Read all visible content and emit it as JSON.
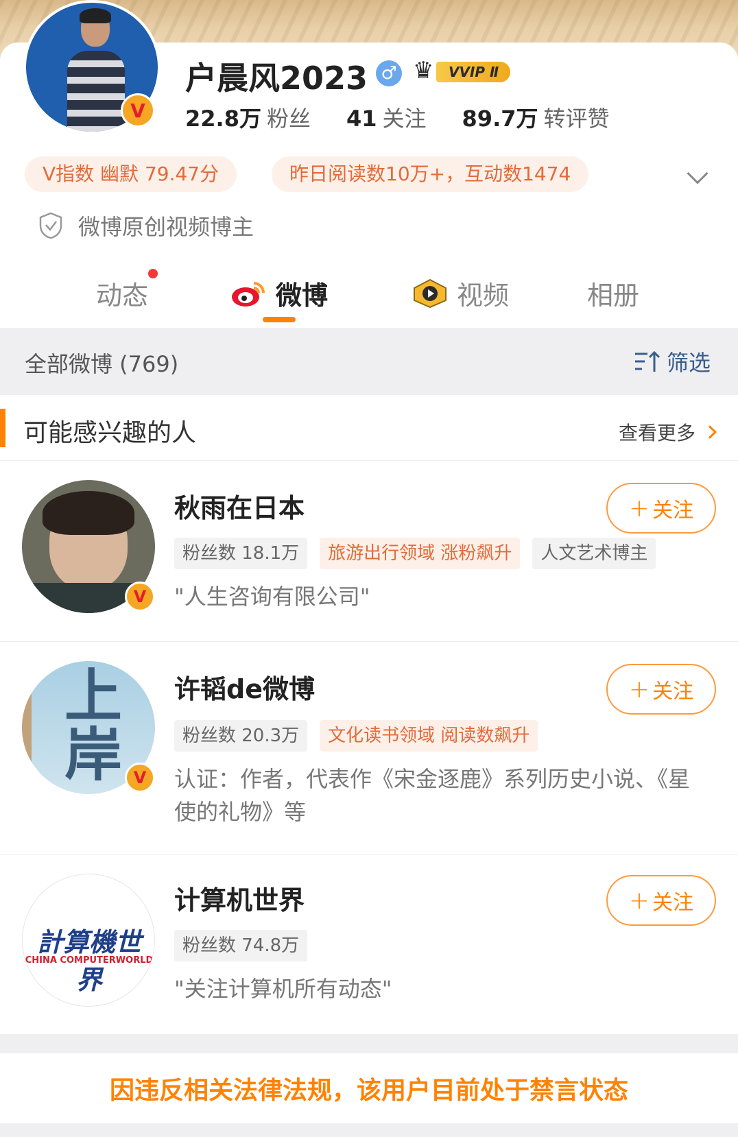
{
  "profile": {
    "name": "户晨风2023",
    "gender_symbol": "♂",
    "membership_badge": "VVIP Ⅱ",
    "verified_badge": "V",
    "stats": [
      {
        "value": "22.8万",
        "label": "粉丝"
      },
      {
        "value": "41",
        "label": "关注"
      },
      {
        "value": "89.7万",
        "label": "转评赞"
      }
    ],
    "chips": [
      "V指数 幽默 79.47分",
      "昨日阅读数10万+，互动数1474"
    ],
    "certification": "微博原创视频博主"
  },
  "tabs": [
    {
      "label": "动态",
      "icon": "",
      "has_dot": true
    },
    {
      "label": "微博",
      "icon": "weibo-logo-icon",
      "active": true
    },
    {
      "label": "视频",
      "icon": "video-play-icon"
    },
    {
      "label": "相册",
      "icon": ""
    }
  ],
  "filter_bar": {
    "count_text": "全部微博 (769)",
    "filter_label": "筛选"
  },
  "suggestions": {
    "title": "可能感兴趣的人",
    "more_label": "查看更多",
    "follow_label": "关注",
    "items": [
      {
        "name": "秋雨在日本",
        "tags": [
          {
            "text": "粉丝数 18.1万",
            "style": "gray"
          },
          {
            "text": "旅游出行领域 涨粉飙升",
            "style": "hot"
          },
          {
            "text": "人文艺术博主",
            "style": "gray"
          }
        ],
        "desc": "\"人生咨询有限公司\"",
        "verified_badge": "V"
      },
      {
        "name": "许韬de微博",
        "tags": [
          {
            "text": "粉丝数 20.3万",
            "style": "gray"
          },
          {
            "text": "文化读书领域 阅读数飙升",
            "style": "hot"
          }
        ],
        "desc": "认证：作者，代表作《宋金逐鹿》系列历史小说、《星使的礼物》等",
        "avatar_text": "上岸",
        "verified_badge": "V"
      },
      {
        "name": "计算机世界",
        "tags": [
          {
            "text": "粉丝数 74.8万",
            "style": "gray"
          }
        ],
        "desc": "\"关注计算机所有动态\"",
        "avatar_logo_cn": "計算機世界",
        "avatar_logo_en": "CHINA COMPUTERWORLD"
      }
    ]
  },
  "notice": "因违反相关法律法规，该用户目前处于禁言状态",
  "colors": {
    "accent": "#ff8200",
    "chip_bg": "#fdf0e8",
    "chip_text": "#e36a3a",
    "link_blue": "#3a5d8a"
  }
}
